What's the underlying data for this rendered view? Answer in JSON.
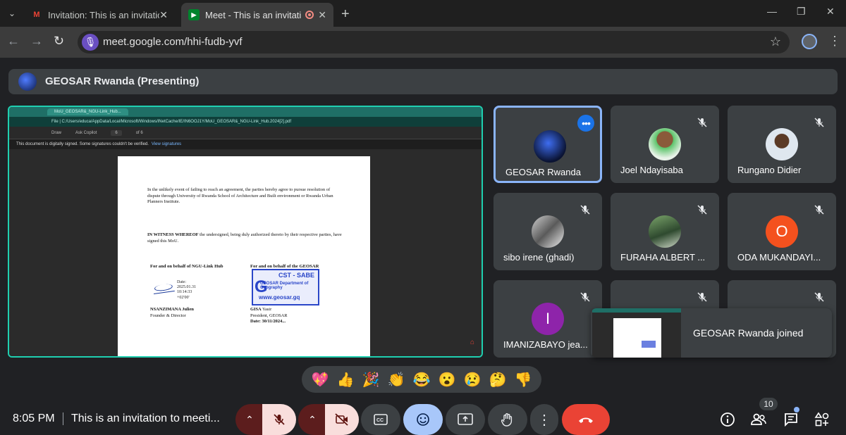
{
  "browser": {
    "tabs": [
      {
        "title": "Invitation: This is an invitation to",
        "favicon": "gmail-icon"
      },
      {
        "title": "Meet - This is an invitation to",
        "favicon": "meet-icon",
        "recording": true
      }
    ],
    "url": "meet.google.com/hhi-fudb-yvf"
  },
  "presenting": {
    "label": "GEOSAR Rwanda (Presenting)"
  },
  "shared_screen": {
    "tab_title": "MoU_GEOSAR&_NGU-Link_Hub...",
    "address": "File  |  C:/Users/educa/AppData/Local/Microsoft/Windows/INetCache/IE/IN6OOJ1Y/MoU_GEOSAR&_NGU-Link_Hub.2024[2].pdf",
    "pdf_toolbar": {
      "draw": "Draw",
      "ask": "Ask Copilot",
      "page": "6",
      "of": "of 6"
    },
    "notice": "This document is digitally signed. Some signatures couldn't be verified.",
    "notice_link": "View signatures",
    "document": {
      "para1": "In the unlikely event of failing to reach an agreement, the parties hereby agree to pursue resolution of dispute through University of Rwanda School of Architecture and Built environment or Rwanda Urban Planners Institute.",
      "para2_bold": "IN WITNESS WHEREOF",
      "para2": " the undersigned, being duly authorized thereto by their respective parties, have signed this MoU.",
      "left_heading": "For and on behalf of NGU-Link Hub",
      "right_heading": "For and on behalf of the GEOSAR",
      "date_block": [
        "Date:",
        "2025.01.31",
        "10:14:33",
        "+02'00'"
      ],
      "left_name": "NSANZIMANA Julien",
      "left_role": "Founder & Director",
      "right_name_bold": "GISA",
      "right_name": " Yasir",
      "right_role": "President, GEOSAR",
      "right_date": "Date: 30/11/2024...",
      "stamp": {
        "line1": "CST - SABE",
        "line2": "GEOSAR Department of Geography",
        "line3": "www.geosar.gq"
      }
    }
  },
  "participants": [
    {
      "name": "GEOSAR Rwanda",
      "avatar": "logo",
      "muted": false,
      "active": true
    },
    {
      "name": "Joel Ndayisaba",
      "avatar": "photo",
      "muted": true
    },
    {
      "name": "Rungano Didier",
      "avatar": "photo",
      "muted": true
    },
    {
      "name": "sibo irene (ghadi)",
      "avatar": "photo",
      "muted": true
    },
    {
      "name": "FURAHA ALBERT ...",
      "avatar": "photo",
      "muted": true
    },
    {
      "name": "ODA MUKANDAYI...",
      "avatar": "O",
      "avatar_color": "#f4511e",
      "muted": true
    },
    {
      "name": "IMANIZABAYO jea...",
      "avatar": "I",
      "avatar_color": "#8e24aa",
      "muted": true
    }
  ],
  "notification": {
    "text": "GEOSAR Rwanda joined"
  },
  "reactions": [
    "💖",
    "👍",
    "🎉",
    "👏",
    "😂",
    "😮",
    "😢",
    "🤔",
    "👎"
  ],
  "bottom": {
    "time": "8:05 PM",
    "meeting_title": "This is an invitation to meeti...",
    "people_count": "10"
  },
  "colors": {
    "accent": "#8ab4f8",
    "end_call": "#ea4335",
    "share_border": "#1fcfb0"
  }
}
